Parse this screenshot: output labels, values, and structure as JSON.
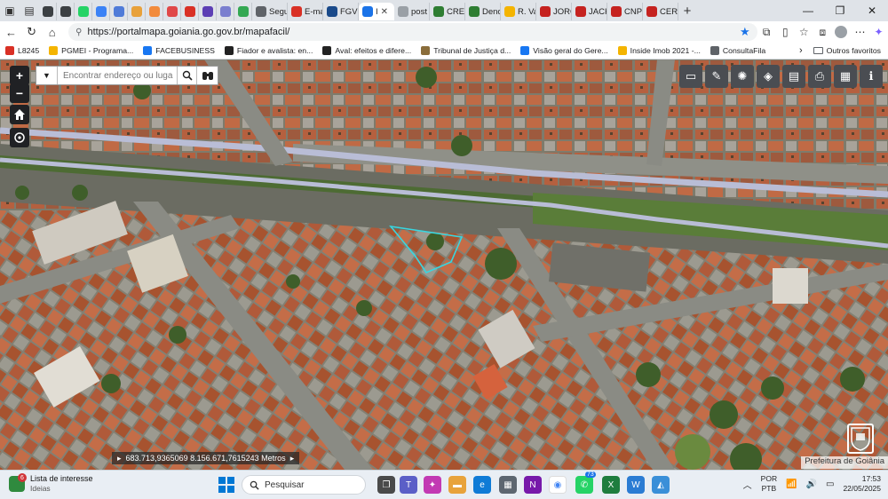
{
  "browser": {
    "tabs": [
      {
        "label": "",
        "color": "#3c4043"
      },
      {
        "label": "",
        "color": "#3c4043"
      },
      {
        "label": "",
        "color": "#25d366"
      },
      {
        "label": "",
        "color": "#3b82f6"
      },
      {
        "label": "",
        "color": "#4f7bd8"
      },
      {
        "label": "",
        "color": "#e8a13a"
      },
      {
        "label": "",
        "color": "#f28b3c"
      },
      {
        "label": "",
        "color": "#e04848"
      },
      {
        "label": "",
        "color": "#d93025"
      },
      {
        "label": "",
        "color": "#5c3fb4"
      },
      {
        "label": "",
        "color": "#7a7fcf"
      },
      {
        "label": "",
        "color": "#34a853"
      },
      {
        "label": "Segu",
        "color": "#5f6368"
      },
      {
        "label": "E-ma",
        "color": "#d93025"
      },
      {
        "label": "FGVE",
        "color": "#1a4a8a"
      },
      {
        "label": "I",
        "color": "#1a73e8",
        "active": true
      },
      {
        "label": "post",
        "color": "#9aa0a6"
      },
      {
        "label": "CREC",
        "color": "#2e7d32"
      },
      {
        "label": "Deno",
        "color": "#2e7d32"
      },
      {
        "label": "R. Va",
        "color": "#f4b400"
      },
      {
        "label": "JORC",
        "color": "#c5221f"
      },
      {
        "label": "JACK",
        "color": "#c5221f"
      },
      {
        "label": "CNPJ",
        "color": "#c5221f"
      },
      {
        "label": "CERT",
        "color": "#c5221f"
      }
    ],
    "url": "https://portalmapa.goiania.go.gov.br/mapafacil/",
    "bookmarks": [
      {
        "label": "L8245",
        "color": "#d93025"
      },
      {
        "label": "PGMEI - Programa...",
        "color": "#f4b400"
      },
      {
        "label": "FACEBUSINESS",
        "color": "#1877f2"
      },
      {
        "label": "Fiador e avalista: en...",
        "color": "#222222"
      },
      {
        "label": "Aval: efeitos e difere...",
        "color": "#222222"
      },
      {
        "label": "Tribunal de Justiça d...",
        "color": "#8a6d3b"
      },
      {
        "label": "Visão geral do Gere...",
        "color": "#1877f2"
      },
      {
        "label": "Inside Imob 2021 -...",
        "color": "#f4b400"
      },
      {
        "label": "ConsultaFila",
        "color": "#5f6368"
      }
    ],
    "other_bookmarks": "Outros favoritos"
  },
  "map": {
    "search_placeholder": "Encontrar endereço ou luga",
    "coordinates": "683.713,9365069 8.156.671,7615243 Metros",
    "attribution": "Prefeitura de Goiânia",
    "colors": {
      "parcel_outline": "#38d6e0",
      "major_road": "#b9bdd6",
      "vegetation": "#4d6b33",
      "rooftop": "#b5603f"
    }
  },
  "taskbar": {
    "widget_badge": "6",
    "widget_title": "Lista de interesse",
    "widget_subtitle": "Ideias",
    "search_label": "Pesquisar",
    "app_badge": "73",
    "language_top": "POR",
    "language_bottom": "PTB",
    "time": "17:53",
    "date": "22/05/2025"
  }
}
